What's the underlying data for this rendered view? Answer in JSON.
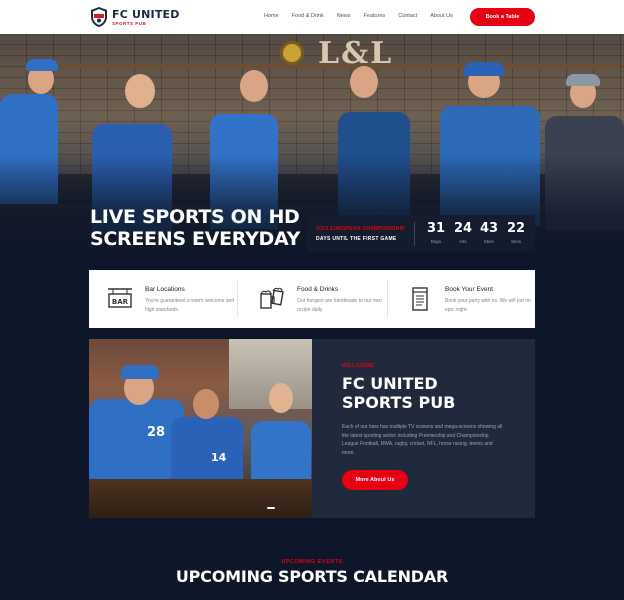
{
  "header": {
    "logo_title": "FC UNITED",
    "logo_subtitle": "SPORTS PUB",
    "nav": [
      "Home",
      "Food & Drink",
      "News",
      "Features",
      "Contact",
      "About Us"
    ],
    "cta_label": "Book a Table"
  },
  "hero": {
    "title_line1": "LIVE SPORTS ON HD",
    "title_line2": "SCREENS EVERYDAY",
    "countdown": {
      "event": "2019 EUROPEAN CHAMPIONSHIP",
      "subtitle": "DAYS UNTIL THE FIRST GAME",
      "units": [
        {
          "value": "31",
          "label": "Days"
        },
        {
          "value": "24",
          "label": "Hrs"
        },
        {
          "value": "43",
          "label": "Mins"
        },
        {
          "value": "22",
          "label": "Secs"
        }
      ]
    }
  },
  "features": [
    {
      "title": "Bar Locations",
      "desc": "You're guaranteed a warm welcome and high standards.",
      "icon": "bar-sign-icon"
    },
    {
      "title": "Food & Drinks",
      "desc": "Our burgers are handmade to our own recipe daily.",
      "icon": "beer-mugs-icon"
    },
    {
      "title": "Book Your Event",
      "desc": "Book your party with us. We will put on epic night.",
      "icon": "notepad-icon"
    }
  ],
  "welcome": {
    "kicker": "WELCOME",
    "title_line1": "FC UNITED",
    "title_line2": "SPORTS PUB",
    "text": "Each of our bars has multiple TV screens and mega-screens showing all the latest sporting action including Premiership and Championship League Football, RWA, rugby, cricket, NFL, horse racing, tennis and more.",
    "button_label": "More About Us",
    "jersey_numbers": [
      "28",
      "14"
    ]
  },
  "upcoming": {
    "kicker": "UPCOMING EVENTS",
    "title": "UPCOMING SPORTS CALENDAR"
  },
  "colors": {
    "accent": "#e60012",
    "navy": "#0e1729",
    "panel": "#202a3c",
    "jersey_blue": "#2f6fc4"
  }
}
